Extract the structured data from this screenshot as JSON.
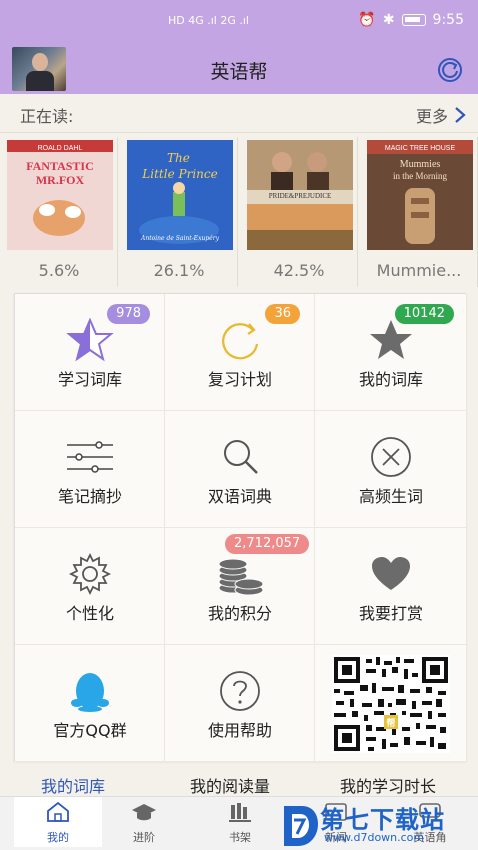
{
  "status_bar": {
    "network": "HD 4G .ıl 2G .ıl",
    "time": "9:55"
  },
  "app": {
    "title": "英语帮"
  },
  "reading": {
    "label": "正在读:",
    "more": "更多",
    "books": [
      {
        "progress": "5.6%"
      },
      {
        "progress": "26.1%"
      },
      {
        "progress": "42.5%"
      },
      {
        "progress": "Mummie..."
      }
    ]
  },
  "grid": {
    "cells": [
      {
        "label": "学习词库",
        "badge": "978",
        "icon": "star-half-icon"
      },
      {
        "label": "复习计划",
        "badge": "36",
        "icon": "refresh-circle-icon"
      },
      {
        "label": "我的词库",
        "badge": "10142",
        "icon": "star-icon"
      },
      {
        "label": "笔记摘抄",
        "icon": "list-sliders-icon"
      },
      {
        "label": "双语词典",
        "icon": "search-icon"
      },
      {
        "label": "高频生词",
        "icon": "close-circle-icon"
      },
      {
        "label": "个性化",
        "icon": "gear-icon"
      },
      {
        "label": "我的积分",
        "badge": "2,712,057",
        "icon": "coins-icon"
      },
      {
        "label": "我要打赏",
        "icon": "heart-icon"
      },
      {
        "label": "官方QQ群",
        "icon": "qq-penguin-icon"
      },
      {
        "label": "使用帮助",
        "icon": "help-icon"
      },
      {
        "label": "",
        "icon": "qr-code"
      }
    ]
  },
  "strip": {
    "items": [
      "我的词库",
      "我的阅读量",
      "我的学习时长"
    ]
  },
  "nav": {
    "items": [
      "我的",
      "进阶",
      "书架",
      "新闻",
      "英语角"
    ]
  },
  "watermark": {
    "title": "第七下载站",
    "url": "www.d7down.com"
  },
  "colors": {
    "header": "#c3a5e3",
    "badge_purple": "#a58ee0",
    "badge_orange": "#f2a33a",
    "badge_green": "#2fa84f",
    "badge_red": "#ef8a8a",
    "accent": "#2f56b8"
  }
}
